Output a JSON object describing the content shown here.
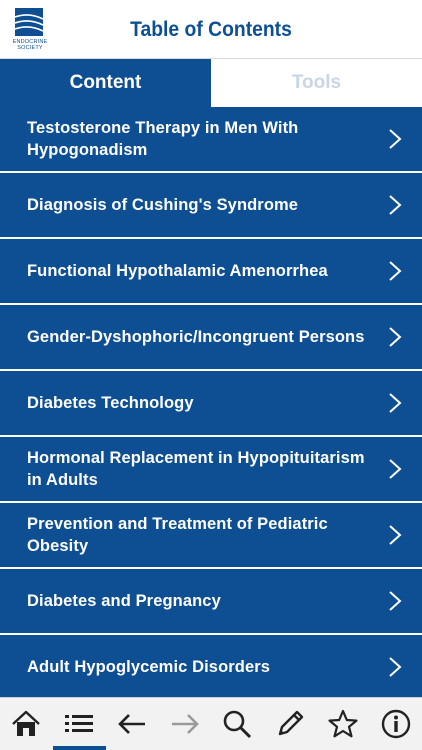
{
  "header": {
    "title": "Table of Contents",
    "logo_text": "ENDOCRINE SOCIETY"
  },
  "tabs": [
    {
      "label": "Content",
      "active": true
    },
    {
      "label": "Tools",
      "active": false
    }
  ],
  "items": [
    {
      "label": "Testosterone Therapy in Men With Hypogonadism"
    },
    {
      "label": "Diagnosis of Cushing's Syndrome"
    },
    {
      "label": "Functional Hypothalamic Amenorrhea"
    },
    {
      "label": "Gender-Dyshophoric/Incongruent Persons"
    },
    {
      "label": "Diabetes Technology"
    },
    {
      "label": "Hormonal Replacement in Hypopituitarism in Adults"
    },
    {
      "label": "Prevention and Treatment of Pediatric Obesity"
    },
    {
      "label": "Diabetes and Pregnancy"
    },
    {
      "label": "Adult Hypoglycemic Disorders"
    }
  ],
  "toolbar": [
    {
      "icon": "home-icon"
    },
    {
      "icon": "list-icon",
      "active": true
    },
    {
      "icon": "arrow-left-icon"
    },
    {
      "icon": "arrow-right-icon"
    },
    {
      "icon": "search-icon"
    },
    {
      "icon": "pencil-icon"
    },
    {
      "icon": "star-icon"
    },
    {
      "icon": "info-icon"
    }
  ],
  "colors": {
    "brand": "#0e4f94",
    "tab_inactive_text": "#c9d6e6",
    "toolbar_bg": "#f2f2f2"
  }
}
